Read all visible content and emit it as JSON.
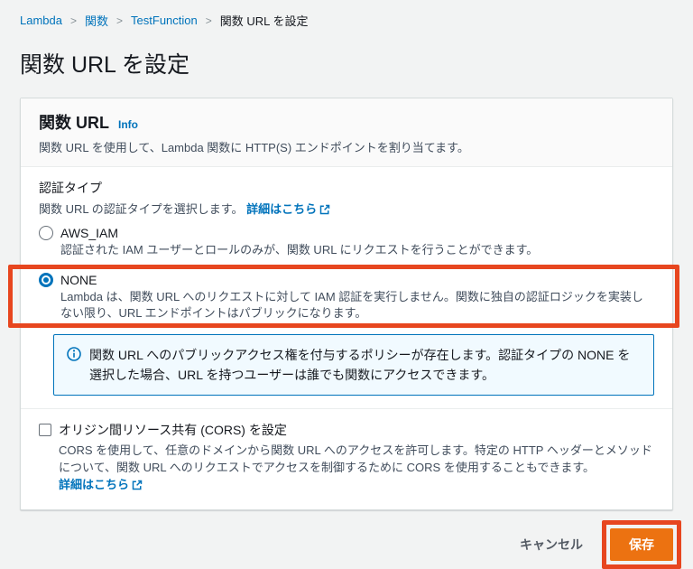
{
  "breadcrumb": {
    "separator": ">",
    "items": [
      {
        "label": "Lambda"
      },
      {
        "label": "関数"
      },
      {
        "label": "TestFunction"
      },
      {
        "label": "関数 URL を設定"
      }
    ]
  },
  "page": {
    "title": "関数 URL を設定"
  },
  "card": {
    "header": {
      "title": "関数 URL",
      "info_link": "Info",
      "description": "関数 URL を使用して、Lambda 関数に HTTP(S) エンドポイントを割り当てます。"
    },
    "auth_section": {
      "label": "認証タイプ",
      "description": "関数 URL の認証タイプを選択します。",
      "learn_more": "詳細はこちら",
      "options": [
        {
          "label": "AWS_IAM",
          "description": "認証された IAM ユーザーとロールのみが、関数 URL にリクエストを行うことができます。",
          "selected": false
        },
        {
          "label": "NONE",
          "description": "Lambda は、関数 URL へのリクエストに対して IAM 認証を実行しません。関数に独自の認証ロジックを実装しない限り、URL エンドポイントはパブリックになります。",
          "selected": true
        }
      ]
    },
    "alert": {
      "text": "関数 URL へのパブリックアクセス権を付与するポリシーが存在します。認証タイプの NONE を選択した場合、URL を持つユーザーは誰でも関数にアクセスできます。"
    },
    "cors_section": {
      "label": "オリジン間リソース共有 (CORS) を設定",
      "description": "CORS を使用して、任意のドメインから関数 URL へのアクセスを許可します。特定の HTTP ヘッダーとメソッドについて、関数 URL へのリクエストでアクセスを制御するために CORS を使用することもできます。",
      "learn_more": "詳細はこちら",
      "checked": false
    }
  },
  "footer": {
    "cancel_label": "キャンセル",
    "save_label": "保存"
  },
  "colors": {
    "link_blue": "#0073bb",
    "primary_button_orange": "#ec7211",
    "annotation_orange": "#e7461f",
    "alert_background": "#f1faff",
    "alert_border": "#0073bb"
  }
}
